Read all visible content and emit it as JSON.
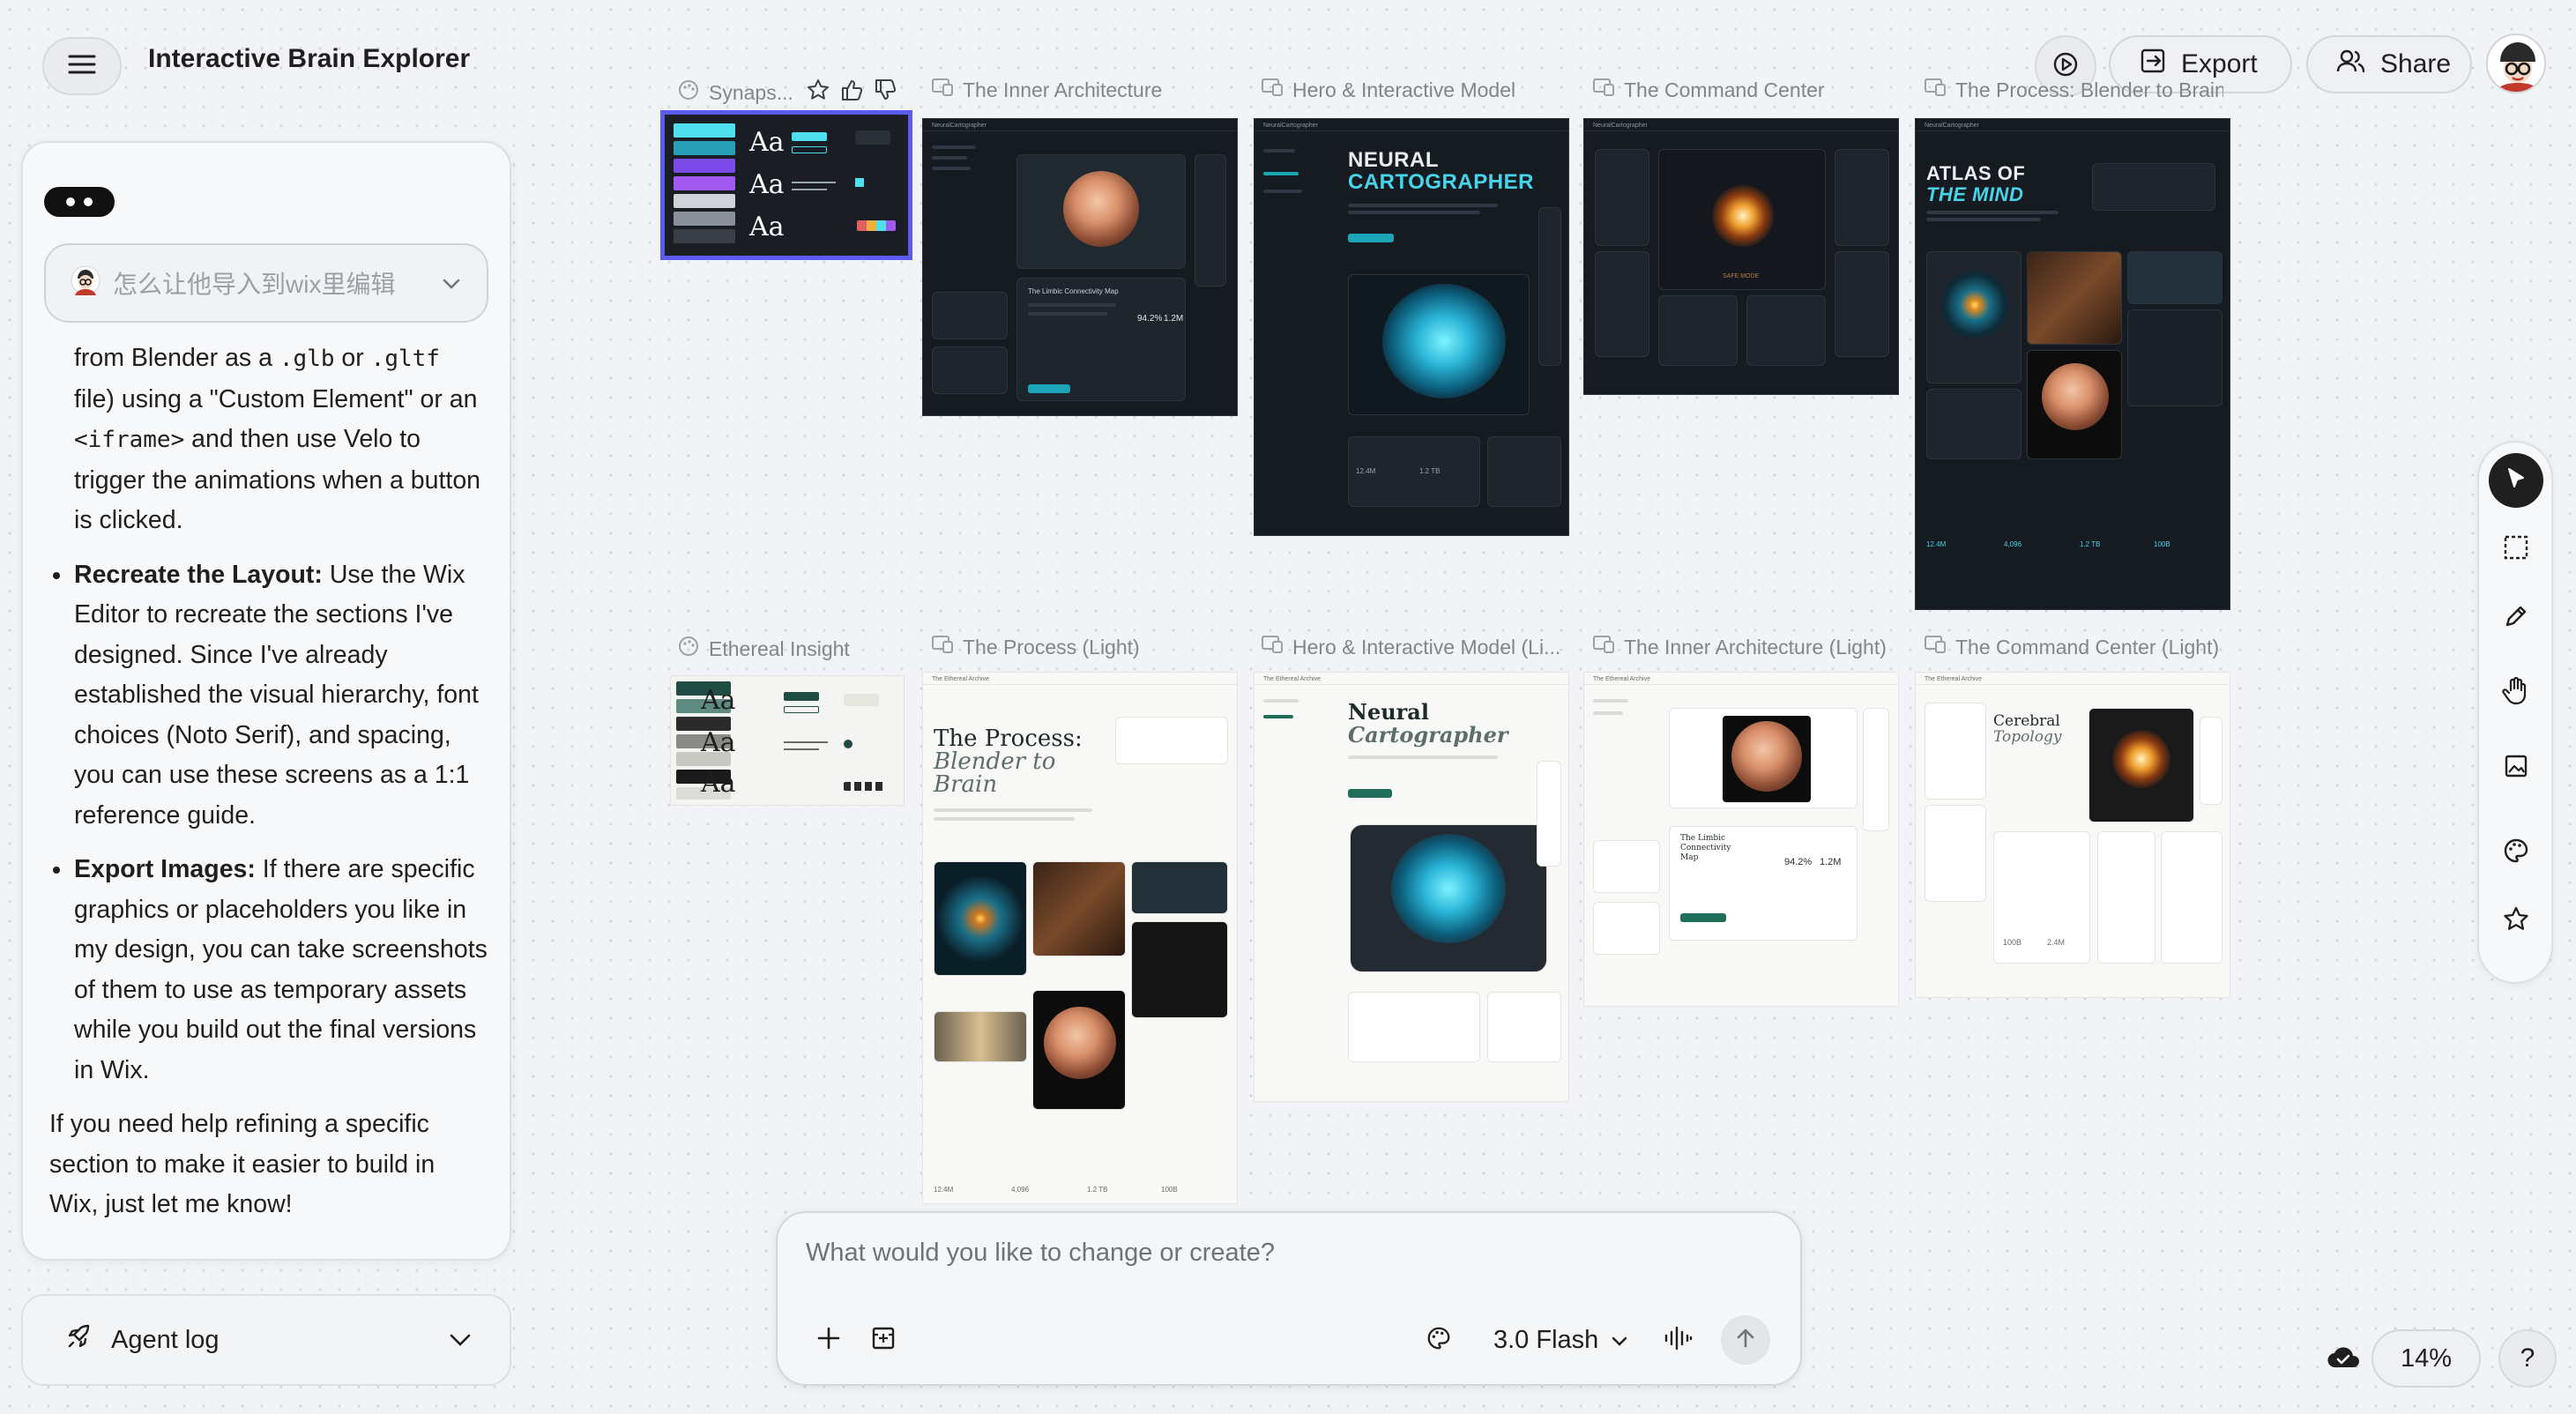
{
  "header": {
    "app_title": "Interactive Brain Explorer",
    "export_label": "Export",
    "share_label": "Share"
  },
  "chat": {
    "prompt_chip": "怎么让他导入到wix里编辑",
    "intro_line1_pre": "from Blender as a ",
    "intro_code1": ".glb",
    "intro_mid": " or ",
    "intro_code2": ".gltf",
    "intro_line2": "file) using a \"Custom Element\" or an",
    "intro_code3": "<iframe>",
    "intro_line3_post": " and then use Velo to trigger the animations when a button is clicked.",
    "bullets": [
      {
        "title": "Recreate the Layout:",
        "text": " Use the Wix Editor to recreate the sections I've designed. Since I've already established the visual hierarchy, font choices (Noto Serif), and spacing, you can use these screens as a 1:1 reference guide."
      },
      {
        "title": "Export Images:",
        "text": " If there are specific graphics or placeholders you like in my design, you can take screenshots of them to use as temporary assets while you build out the final versions in Wix."
      }
    ],
    "closing": "If you need help refining a specific section to make it easier to build in Wix, just let me know!",
    "agent_log_label": "Agent log"
  },
  "frames": {
    "row1": [
      {
        "label": "Synaps...",
        "kind": "style-guide"
      },
      {
        "label": "The Inner Architecture",
        "kind": "dark"
      },
      {
        "label": "Hero & Interactive Model",
        "kind": "dark"
      },
      {
        "label": "The Command Center",
        "kind": "dark"
      },
      {
        "label": "The Process: Blender to Brain",
        "kind": "dark"
      }
    ],
    "row2": [
      {
        "label": "Ethereal Insight",
        "kind": "style-guide"
      },
      {
        "label": "The Process (Light)",
        "kind": "light"
      },
      {
        "label": "Hero & Interactive Model (Li...",
        "kind": "light"
      },
      {
        "label": "The Inner Architecture (Light)",
        "kind": "light"
      },
      {
        "label": "The Command Center (Light)",
        "kind": "light"
      }
    ]
  },
  "mock": {
    "brand_dark": "NeuralCartographer",
    "brand_light": "The Ethereal Archive",
    "style_sample": "Aa",
    "hero_title_1": "NEURAL",
    "hero_title_2": "CARTOGRAPHER",
    "atlas_title_1": "ATLAS OF",
    "atlas_title_2": "THE MIND",
    "inner_card_title": "The Limbic Connectivity Map",
    "stat_1": "94.2%",
    "stat_2": "1.2M",
    "process_title_1": "The Process:",
    "process_title_2": "Blender to",
    "process_title_3": "Brain",
    "neural_light_1": "Neural",
    "neural_light_2": "Cartographer",
    "cerebral_1": "Cerebral",
    "cerebral_2": "Topology",
    "limbic_light": "The Limbic Connectivity Map",
    "stat_light_1": "94.2%",
    "stat_light_2": "1.2M",
    "bottom_stats": [
      "12.4M",
      "4,096",
      "1.2 TB",
      "100B"
    ],
    "safe_mode": "SAFE MODE",
    "cmd_stats": [
      "100B",
      "2.4M"
    ]
  },
  "prompt": {
    "placeholder": "What would you like to change or create?",
    "model_label": "3.0 Flash"
  },
  "footer": {
    "zoom": "14%"
  },
  "colors": {
    "selection": "#5b5bf0",
    "teal_accent": "#47d4ea",
    "canvas_bg": "#f1f3f6"
  }
}
